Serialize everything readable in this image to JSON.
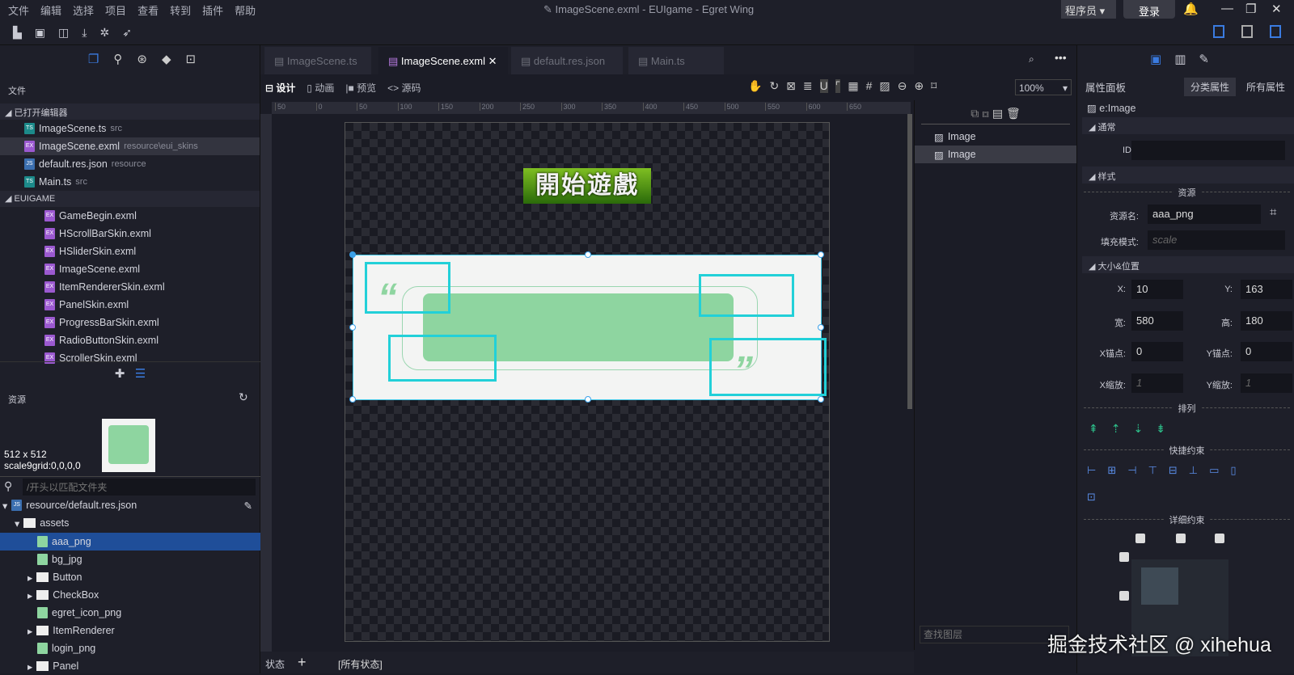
{
  "menu": [
    "文件",
    "编辑",
    "选择",
    "项目",
    "查看",
    "转到",
    "插件",
    "帮助"
  ],
  "window_title": "ImageScene.exml - EUIgame - Egret Wing",
  "user": {
    "role": "程序员",
    "login": "登录"
  },
  "left": {
    "files_header": "文件",
    "open_editors_label": "已打开编辑器",
    "open_editors": [
      {
        "name": "ImageScene.ts",
        "path": "src",
        "type": "TS"
      },
      {
        "name": "ImageScene.exml",
        "path": "resource\\eui_skins",
        "type": "EX"
      },
      {
        "name": "default.res.json",
        "path": "resource",
        "type": "JSON"
      },
      {
        "name": "Main.ts",
        "path": "src",
        "type": "TS"
      }
    ],
    "project_label": "EUIGAME",
    "project_files": [
      "GameBegin.exml",
      "HScrollBarSkin.exml",
      "HSliderSkin.exml",
      "ImageScene.exml",
      "ItemRendererSkin.exml",
      "PanelSkin.exml",
      "ProgressBarSkin.exml",
      "RadioButtonSkin.exml",
      "ScrollerSkin.exml"
    ],
    "resources_label": "资源",
    "preview_size": "512 x 512",
    "preview_scale9": "scale9grid:0,0,0,0",
    "search_placeholder": "/开头以匹配文件夹",
    "res_root": "resource/default.res.json",
    "res_folder": "assets",
    "res_items": [
      {
        "name": "aaa_png",
        "kind": "image",
        "selected": true
      },
      {
        "name": "bg_jpg",
        "kind": "image"
      },
      {
        "name": "Button",
        "kind": "folder"
      },
      {
        "name": "CheckBox",
        "kind": "folder"
      },
      {
        "name": "egret_icon_png",
        "kind": "image"
      },
      {
        "name": "ItemRenderer",
        "kind": "folder"
      },
      {
        "name": "login_png",
        "kind": "image"
      },
      {
        "name": "Panel",
        "kind": "folder"
      }
    ]
  },
  "tabs": [
    {
      "label": "ImageScene.ts"
    },
    {
      "label": "ImageScene.exml",
      "active": true
    },
    {
      "label": "default.res.json"
    },
    {
      "label": "Main.ts"
    }
  ],
  "design_modes": [
    "设计",
    "动画",
    "预览",
    "源码"
  ],
  "zoom": "100%",
  "ruler_ticks": [
    "50",
    "0",
    "50",
    "100",
    "150",
    "200",
    "250",
    "300",
    "350",
    "400",
    "450",
    "500",
    "550",
    "600",
    "650"
  ],
  "canvas": {
    "button_text": "開始遊戲"
  },
  "layers": {
    "items": [
      "Image",
      "Image"
    ],
    "search_placeholder": "查找图层"
  },
  "bottom": {
    "state_label": "状态",
    "add": "+",
    "all_states": "[所有状态]"
  },
  "props": {
    "title": "属性面板",
    "tab_category": "分类属性",
    "tab_all": "所有属性",
    "component": "e:Image",
    "sec_general": "通常",
    "id_label": "ID:",
    "id_value": "",
    "sec_style": "样式",
    "res_divider": "资源",
    "source_label": "资源名:",
    "source_value": "aaa_png",
    "fill_label": "填充模式:",
    "fill_placeholder": "scale",
    "sec_size": "大小&位置",
    "x_label": "X:",
    "x": "10",
    "y_label": "Y:",
    "y": "163",
    "w_label": "宽:",
    "w": "580",
    "h_label": "高:",
    "h": "180",
    "ax_label": "X锚点:",
    "ax": "0",
    "ay_label": "Y锚点:",
    "ay": "0",
    "sx_label": "X缩放:",
    "sx": "1",
    "sy_label": "Y缩放:",
    "sy": "1",
    "arrange": "排列",
    "quick": "快捷约束",
    "detail": "详细约束"
  },
  "watermark": "掘金技术社区 @ xihehua",
  "colors": {
    "accent": "#3a7be0",
    "selection": "#22d0d8",
    "selected_row": "#1f4e99"
  }
}
